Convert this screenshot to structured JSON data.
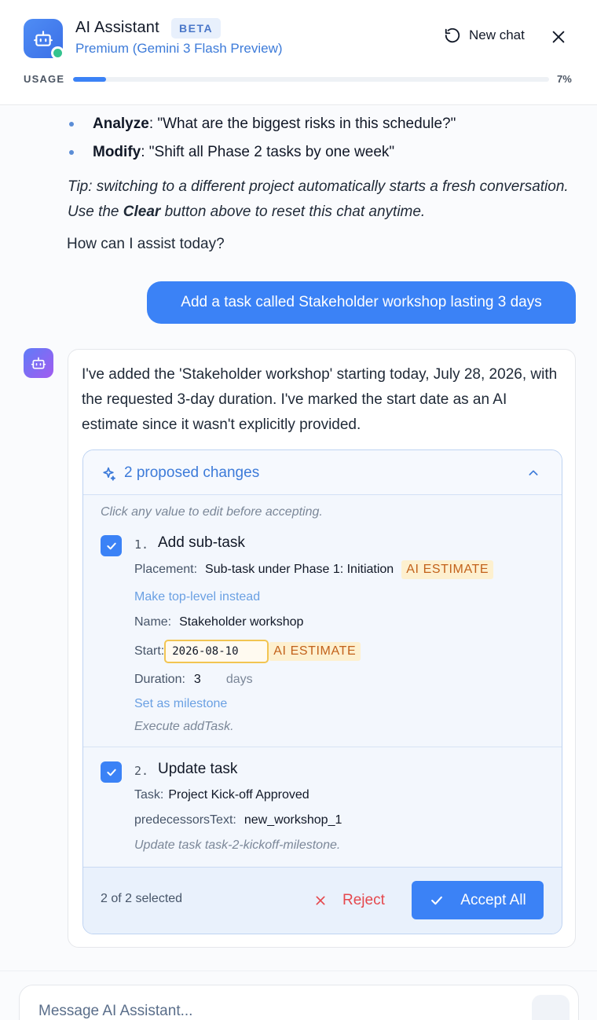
{
  "header": {
    "title": "AI Assistant",
    "badge": "BETA",
    "subtitle": "Premium (Gemini 3 Flash Preview)",
    "new_chat_label": "New chat",
    "usage_label": "USAGE",
    "usage_percent_text": "7%",
    "usage_fraction": 0.07
  },
  "messages": {
    "bullets": [
      {
        "bold": "Analyze",
        "text": ": \"What are the biggest risks in this schedule?\""
      },
      {
        "bold": "Modify",
        "text": ": \"Shift all Phase 2 tasks by one week\""
      }
    ],
    "tip_prefix": "Tip: switching to a different project automatically starts a fresh conversation. Use the ",
    "tip_bold": "Clear",
    "tip_suffix": " button above to reset this chat anytime.",
    "closing": "How can I assist today?",
    "user_message": "Add a task called Stakeholder workshop lasting 3 days",
    "assistant_text": "I've added the 'Stakeholder workshop' starting today, July 28, 2026, with the requested 3-day duration. I've marked the start date as an AI estimate since it wasn't explicitly provided."
  },
  "changes": {
    "title": "2 proposed changes",
    "hint": "Click any value to edit before accepting.",
    "item1": {
      "number": "1.",
      "title": "Add sub-task",
      "placement_label": "Placement:",
      "placement_value": "Sub-task under Phase 1: Initiation",
      "ai_badge": "AI ESTIMATE",
      "make_top_level": "Make top-level instead",
      "name_label": "Name:",
      "name_value": "Stakeholder workshop",
      "start_label": "Start:",
      "start_value": "2026-08-10",
      "start_badge": "AI ESTIMATE",
      "duration_label": "Duration:",
      "duration_value": "3",
      "duration_unit": "days",
      "milestone_link": "Set as milestone",
      "exec": "Execute addTask."
    },
    "item2": {
      "number": "2.",
      "title": "Update task",
      "task_label": "Task:",
      "task_value": "Project Kick-off Approved",
      "pred_label": "predecessorsText:",
      "pred_value": "new_workshop_1",
      "exec": "Update task task-2-kickoff-milestone."
    },
    "selected_text": "2 of 2 selected",
    "reject_label": "Reject",
    "accept_label": "Accept All"
  },
  "composer": {
    "placeholder": "Message AI Assistant..."
  },
  "colors": {
    "accent": "#3b82f6",
    "estimate_bg": "#fdf0cf",
    "estimate_text": "#c2611a",
    "reject": "#e5484d"
  }
}
